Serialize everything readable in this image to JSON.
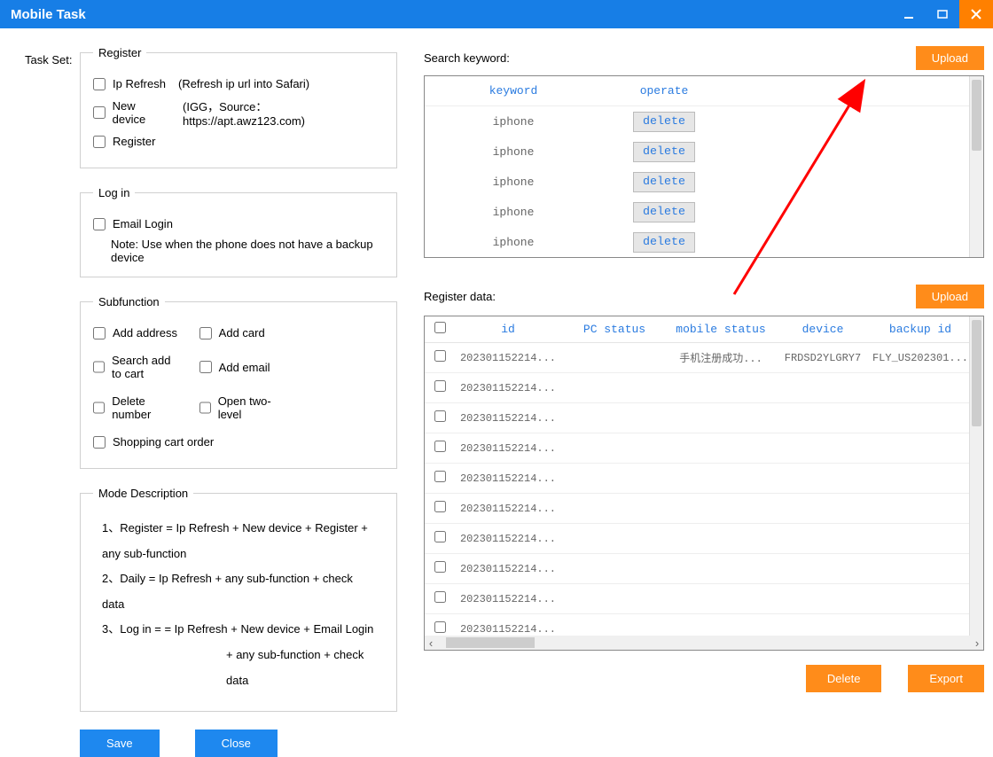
{
  "titlebar": {
    "title": "Mobile Task"
  },
  "taskSetLabel": "Task Set:",
  "register": {
    "legend": "Register",
    "ipRefresh": "Ip Refresh",
    "ipRefreshSuffix": "(Refresh ip url into Safari)",
    "newDevice": "New device",
    "newDeviceSuffix": "(IGG，Source：https://apt.awz123.com)",
    "registerLabel": "Register"
  },
  "login": {
    "legend": "Log in",
    "emailLogin": "Email Login",
    "note": "Note: Use when the phone does not have a backup device"
  },
  "sub": {
    "legend": "Subfunction",
    "addAddress": "Add address",
    "addCard": "Add card",
    "searchAdd": "Search add to cart",
    "addEmail": "Add email",
    "deleteNumber": "Delete number",
    "openTwo": "Open two-level",
    "shopping": "Shopping cart order"
  },
  "mode": {
    "legend": "Mode Description",
    "l1": "1、Register = Ip Refresh + New device + Register + any sub-function",
    "l2": "2、Daily =   Ip Refresh + any sub-function + check data",
    "l3": "3、Log in =  = Ip Refresh + New device + Email Login",
    "l4": "+ any sub-function + check data"
  },
  "buttons": {
    "save": "Save",
    "close": "Close",
    "upload": "Upload",
    "delete": "Delete",
    "export": "Export"
  },
  "keywordSection": {
    "label": "Search keyword:",
    "headKeyword": "keyword",
    "headOperate": "operate",
    "deleteLabel": "delete",
    "rows": [
      {
        "kw": "iphone"
      },
      {
        "kw": "iphone"
      },
      {
        "kw": "iphone"
      },
      {
        "kw": "iphone"
      },
      {
        "kw": "iphone"
      }
    ]
  },
  "dataSection": {
    "label": "Register data:",
    "head": {
      "id": "id",
      "pc": "PC status",
      "mobile": "mobile status",
      "device": "device",
      "backup": "backup id"
    },
    "rows": [
      {
        "id": "202301152214...",
        "pc": "",
        "mobile": "手机注册成功...",
        "device": "FRDSD2YLGRY7",
        "backup": "FLY_US202301..."
      },
      {
        "id": "202301152214...",
        "pc": "",
        "mobile": "",
        "device": "",
        "backup": ""
      },
      {
        "id": "202301152214...",
        "pc": "",
        "mobile": "",
        "device": "",
        "backup": ""
      },
      {
        "id": "202301152214...",
        "pc": "",
        "mobile": "",
        "device": "",
        "backup": ""
      },
      {
        "id": "202301152214...",
        "pc": "",
        "mobile": "",
        "device": "",
        "backup": ""
      },
      {
        "id": "202301152214...",
        "pc": "",
        "mobile": "",
        "device": "",
        "backup": ""
      },
      {
        "id": "202301152214...",
        "pc": "",
        "mobile": "",
        "device": "",
        "backup": ""
      },
      {
        "id": "202301152214...",
        "pc": "",
        "mobile": "",
        "device": "",
        "backup": ""
      },
      {
        "id": "202301152214...",
        "pc": "",
        "mobile": "",
        "device": "",
        "backup": ""
      },
      {
        "id": "202301152214...",
        "pc": "",
        "mobile": "",
        "device": "",
        "backup": ""
      }
    ]
  }
}
